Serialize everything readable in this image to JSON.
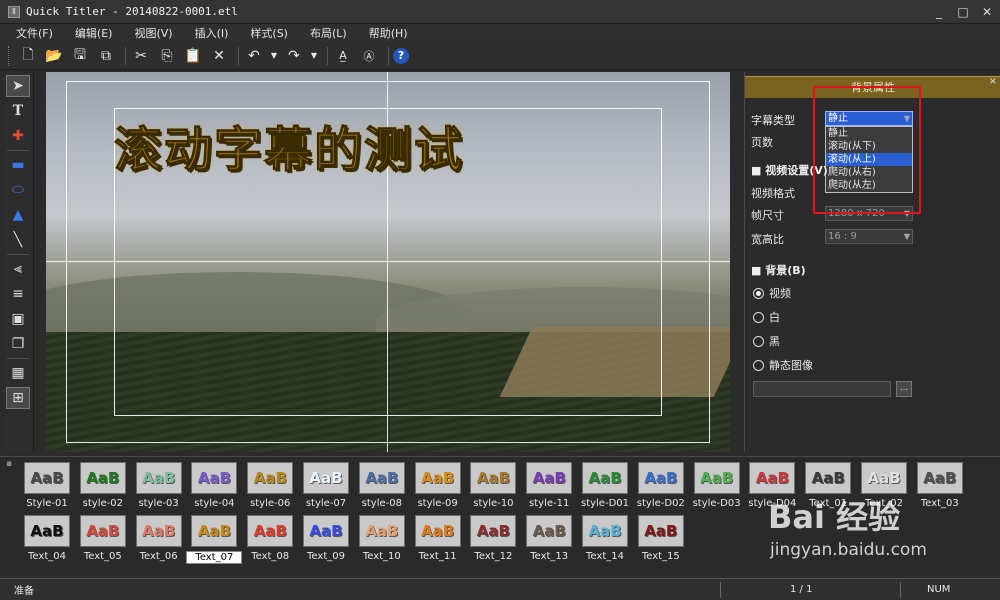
{
  "window": {
    "title": "Quick Titler - 20140822-0001.etl",
    "min": "_",
    "max": "□",
    "close": "✕"
  },
  "menu": [
    "文件(F)",
    "编辑(E)",
    "视图(V)",
    "插入(I)",
    "样式(S)",
    "布局(L)",
    "帮助(H)"
  ],
  "toolbar_icons": [
    "new-icon",
    "open-icon",
    "save-icon",
    "save-all-icon",
    "cut-icon",
    "copy-icon",
    "paste-icon",
    "delete-icon",
    "undo-icon",
    "redo-icon",
    "text-style-icon",
    "text-effect-icon",
    "help-icon"
  ],
  "left_tools": [
    "pointer-icon",
    "text-icon",
    "move-icon",
    "rectangle-icon",
    "ellipse-icon",
    "triangle-icon",
    "line-icon",
    "align-left-icon",
    "align-center-icon",
    "center-icon",
    "layer-icon",
    "grid-icon",
    "safe-area-icon"
  ],
  "canvas": {
    "title_text": "滚动字幕的测试"
  },
  "props": {
    "header": "背景属性",
    "close": "×",
    "subtitle_type_label": "字幕类型",
    "subtitle_type_value": "静止",
    "pages_label": "页数",
    "dropdown_options": [
      "静止",
      "滚动(从下)",
      "滚动(从上)",
      "爬动(从右)",
      "爬动(从左)"
    ],
    "dropdown_selected_index": 2,
    "video_section": "视频设置(V)",
    "video_format_label": "视频格式",
    "frame_size_label": "帧尺寸",
    "frame_size_value": "1280 x 720",
    "aspect_label": "宽高比",
    "aspect_value": "16 : 9",
    "bg_section": "背景(B)",
    "bg_options": [
      "视频",
      "白",
      "黑",
      "静态图像"
    ],
    "bg_selected_index": 0,
    "browse": "..."
  },
  "styles_row1": [
    {
      "label": "Style-01",
      "fg": "#4a4a4a"
    },
    {
      "label": "style-02",
      "fg": "#1d7a1d"
    },
    {
      "label": "style-03",
      "fg": "#7fbf9f"
    },
    {
      "label": "style-04",
      "fg": "#7a5ac8"
    },
    {
      "label": "style-06",
      "fg": "#b58a1a"
    },
    {
      "label": "style-07",
      "fg": "#e9f2ff"
    },
    {
      "label": "style-08",
      "fg": "#4d6fa8"
    },
    {
      "label": "style-09",
      "fg": "#d98a1a"
    },
    {
      "label": "style-10",
      "fg": "#a87a2a"
    },
    {
      "label": "style-11",
      "fg": "#7a3ab5"
    },
    {
      "label": "style-D01",
      "fg": "#2c8a3a"
    },
    {
      "label": "style-D02",
      "fg": "#3a6ec8"
    },
    {
      "label": "style-D03",
      "fg": "#4fb04f"
    },
    {
      "label": "style-D04",
      "fg": "#c83a3a"
    },
    {
      "label": "Text_01",
      "fg": "#3a3a3a"
    },
    {
      "label": "Text_02",
      "fg": "#e0e0e0"
    },
    {
      "label": "Text_03",
      "fg": "#505050"
    }
  ],
  "styles_row2": [
    {
      "label": "Text_04",
      "fg": "#111111"
    },
    {
      "label": "Text_05",
      "fg": "#d04a3a"
    },
    {
      "label": "Text_06",
      "fg": "#e07a6a"
    },
    {
      "label": "Text_07",
      "fg": "#c48a1a"
    },
    {
      "label": "Text_08",
      "fg": "#e03a2a"
    },
    {
      "label": "Text_09",
      "fg": "#3a4ae0"
    },
    {
      "label": "Text_10",
      "fg": "#e0a070"
    },
    {
      "label": "Text_11",
      "fg": "#e07a1a"
    },
    {
      "label": "Text_12",
      "fg": "#8a2a2a"
    },
    {
      "label": "Text_13",
      "fg": "#6a5a4a"
    },
    {
      "label": "Text_14",
      "fg": "#5ab0d8"
    },
    {
      "label": "Text_15",
      "fg": "#7a1a1a"
    }
  ],
  "swatch_text": "AaB",
  "selected_style": "Text_07",
  "status": {
    "left": "准备",
    "page": "1 / 1",
    "num": "NUM"
  },
  "watermark": {
    "logo": "Bai 经验",
    "url": "jingyan.baidu.com"
  }
}
